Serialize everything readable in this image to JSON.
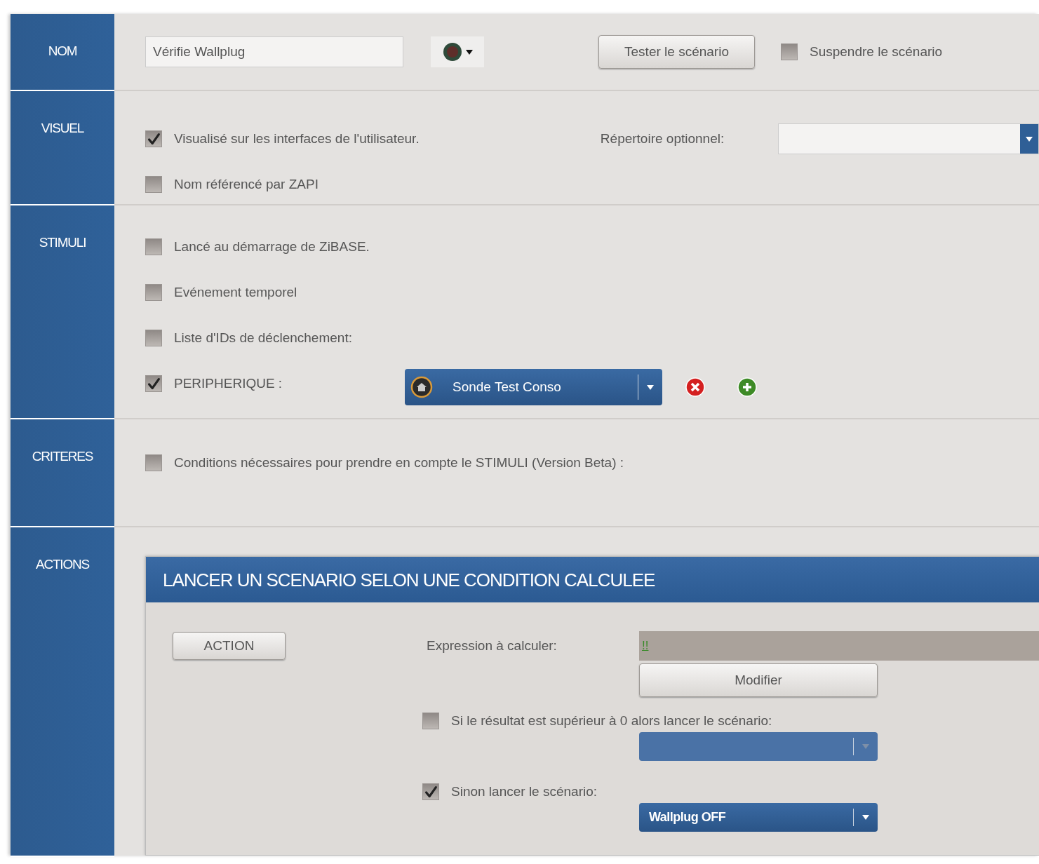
{
  "nom": {
    "label": "NOM",
    "name_value": "Vérifie Wallplug",
    "test_button": "Tester le scénario",
    "suspend": {
      "label": "Suspendre le scénario",
      "checked": false
    }
  },
  "visuel": {
    "label": "VISUEL",
    "options": [
      {
        "label": "Visualisé sur les interfaces de l'utilisateur.",
        "checked": true
      },
      {
        "label": "Nom référencé par ZAPI",
        "checked": false
      }
    ],
    "directory_label": "Répertoire optionnel:"
  },
  "stimuli": {
    "label": "STIMULI",
    "options": [
      {
        "label": "Lancé au démarrage de ZiBASE.",
        "checked": false
      },
      {
        "label": "Evénement temporel",
        "checked": false
      },
      {
        "label": "Liste d'IDs de déclenchement:",
        "checked": false
      },
      {
        "label": "PERIPHERIQUE :",
        "checked": true,
        "device": "Sonde Test Conso"
      }
    ]
  },
  "criteres": {
    "label": "CRITERES",
    "options": [
      {
        "label": "Conditions nécessaires pour prendre en compte le STIMULI (Version Beta) :",
        "checked": false
      }
    ]
  },
  "actions": {
    "label": "ACTIONS",
    "panel_title": "LANCER UN SCENARIO SELON UNE CONDITION CALCULEE",
    "action_button": "ACTION",
    "expression_label": "Expression à calculer:",
    "expression_value": "!!",
    "modify_button": "Modifier",
    "branches": [
      {
        "label": "Si le résultat est supérieur à 0 alors lancer le scénario:",
        "checked": false
      },
      {
        "label": "Sinon lancer le scénario:",
        "checked": true,
        "scenario": "Wallplug OFF"
      }
    ]
  }
}
